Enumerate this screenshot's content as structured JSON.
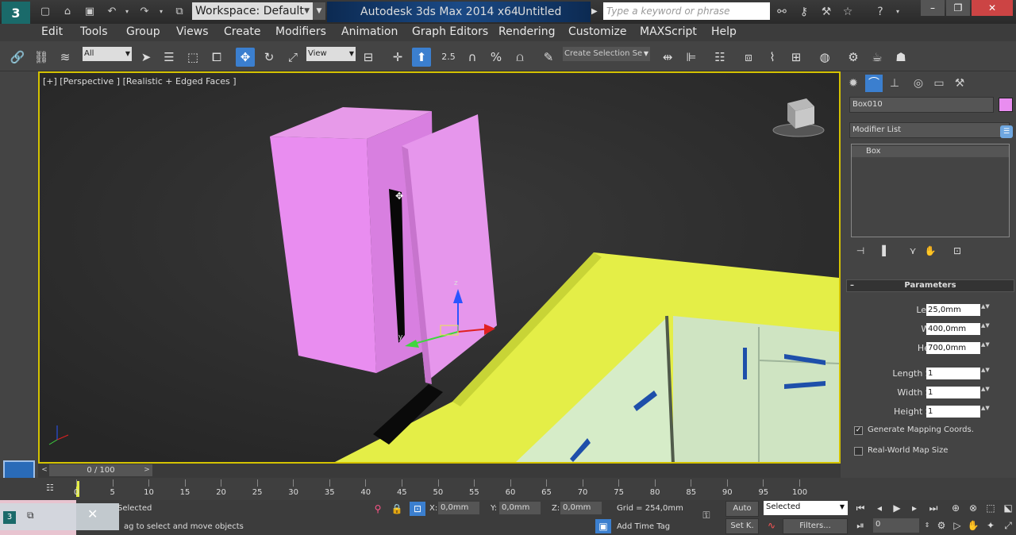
{
  "title_bar": {
    "workspace": "Workspace: Default",
    "app_title": "Autodesk 3ds Max  2014 x64",
    "doc_title": "Untitled",
    "search_placeholder": "Type a keyword or phrase"
  },
  "menu": [
    "Edit",
    "Tools",
    "Group",
    "Views",
    "Create",
    "Modifiers",
    "Animation",
    "Graph Editors",
    "Rendering",
    "Customize",
    "MAXScript",
    "Help"
  ],
  "toolbar": {
    "filter_value": "All",
    "refcoord_value": "View",
    "snap_angle_label": "2.5",
    "named_selection_placeholder": "Create Selection Se"
  },
  "viewport": {
    "label": "[+] [Perspective ] [Realistic + Edged Faces ]",
    "gizmo_z": "z",
    "gizmo_y": "y",
    "colors": {
      "border": "#d4c200",
      "box_pink": "#e98df0",
      "counter_yellow": "#e9f24a",
      "cabinet": "#d6ecc8",
      "handle": "#1e4faa"
    }
  },
  "command_panel": {
    "object_name": "Box010",
    "object_color": "#e98df0",
    "modifier_list": "Modifier List",
    "stack_item": "Box",
    "parameters_title": "Parameters",
    "params": [
      {
        "label": "Length:",
        "value": "25,0mm"
      },
      {
        "label": "Width:",
        "value": "400,0mm"
      },
      {
        "label": "Height:",
        "value": "700,0mm"
      },
      {
        "label": "Length Segs:",
        "value": "1"
      },
      {
        "label": "Width Segs:",
        "value": "1"
      },
      {
        "label": "Height Segs:",
        "value": "1"
      }
    ],
    "gen_mapping_label": "Generate Mapping Coords.",
    "gen_mapping_checked": true,
    "real_world_label": "Real-World Map Size",
    "real_world_checked": false
  },
  "timeline": {
    "frame_slider": "0 / 100",
    "ticks": [
      "0",
      "5",
      "10",
      "15",
      "20",
      "25",
      "30",
      "35",
      "40",
      "45",
      "50",
      "55",
      "60",
      "65",
      "70",
      "75",
      "80",
      "85",
      "90",
      "95",
      "100"
    ]
  },
  "status": {
    "selection_status": "Selected",
    "prompt": "ag to select and move objects",
    "x_label": "X:",
    "x_value": "0,0mm",
    "y_label": "Y:",
    "y_value": "0,0mm",
    "z_label": "Z:",
    "z_value": "0,0mm",
    "grid": "Grid = 254,0mm",
    "add_time_tag": "Add Time Tag",
    "auto_key": "Auto",
    "set_key": "Set K.",
    "key_filter_value": "Selected",
    "filters": "Filters...",
    "current_frame": "0"
  }
}
